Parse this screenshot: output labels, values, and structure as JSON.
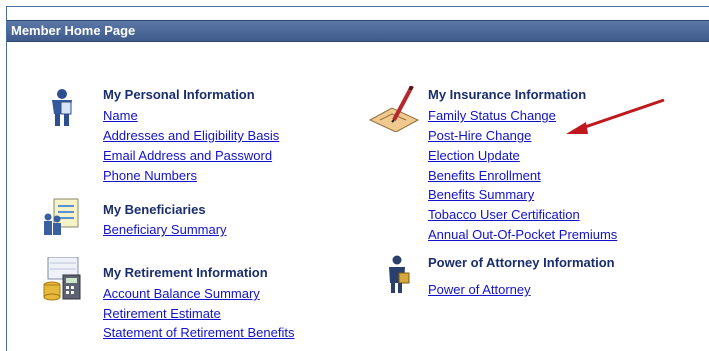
{
  "header": {
    "title": "Member Home Page"
  },
  "personal": {
    "heading": "My Personal Information",
    "links": [
      "Name",
      "Addresses and Eligibility Basis",
      "Email Address and Password",
      "Phone Numbers"
    ]
  },
  "beneficiaries": {
    "heading": "My Beneficiaries",
    "links": [
      "Beneficiary Summary"
    ]
  },
  "retirement": {
    "heading": "My Retirement Information",
    "links": [
      "Account Balance Summary",
      "Retirement Estimate",
      "Statement of Retirement Benefits"
    ]
  },
  "insurance": {
    "heading": "My Insurance Information",
    "links": [
      "Family Status Change",
      "Post-Hire Change",
      "Election Update",
      "Benefits Enrollment",
      "Benefits Summary",
      "Tobacco User Certification",
      "Annual Out-Of-Pocket Premiums"
    ]
  },
  "attorney": {
    "heading": "Power of Attorney Information",
    "links": [
      "Power of Attorney"
    ]
  },
  "colors": {
    "header_bg": "#4a689a",
    "link": "#1313c9",
    "heading": "#1a2e6e",
    "arrow": "#c0181c"
  }
}
